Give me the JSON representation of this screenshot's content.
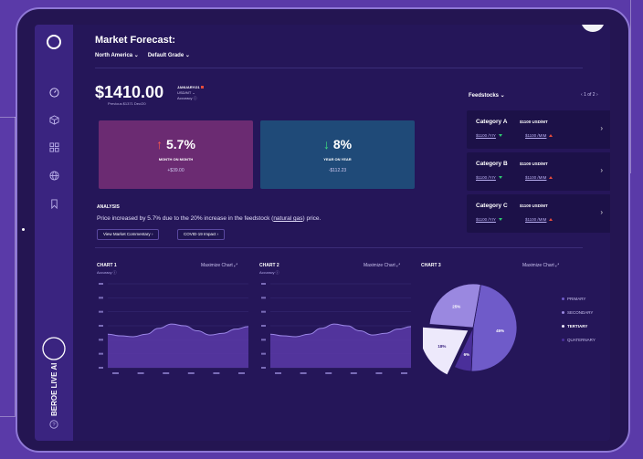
{
  "header": {
    "title": "Market Forecast:",
    "region": "North America",
    "grade": "Default Grade"
  },
  "price": {
    "value": "$1410.00",
    "date": "JANUARY/21",
    "unit": "USD/MT",
    "accuracy_label": "Accuracy",
    "previous": "Previous $1371 Dec/20"
  },
  "kpis": [
    {
      "value": "5.7%",
      "label": "MONTH ON MONTH",
      "amount": "+$39.00",
      "direction": "up",
      "color": "#6b2b72"
    },
    {
      "value": "8%",
      "label": "YEAR ON YEAR",
      "amount": "-$112.23",
      "direction": "down",
      "color": "#1f4a78"
    }
  ],
  "analysis": {
    "heading": "ANALYSIS",
    "text_before": "Price increased by 5.7% due to the 20% increase in the feedstock (",
    "text_link": "natural gas",
    "text_after": ") price.",
    "btn_commentary": "View Market Commentary",
    "btn_covid": "COVID-19 Impact"
  },
  "feedstocks": {
    "heading": "Feedstocks",
    "pager": "1 of 2",
    "items": [
      {
        "name": "Category A",
        "price": "$1100 USD/MT",
        "yoy": "$1100 /YIY",
        "mom": "$1100 /MIM"
      },
      {
        "name": "Category B",
        "price": "$1100 USD/MT",
        "yoy": "$1100 /YIY",
        "mom": "$1100 /MIM"
      },
      {
        "name": "Category C",
        "price": "$1100 USD/MT",
        "yoy": "$1100 /YIY",
        "mom": "$1100 /MIM"
      }
    ]
  },
  "charts": {
    "chart1": {
      "title": "CHART 1",
      "subtitle": "Accuracy",
      "maximize": "Maximize Chart"
    },
    "chart2": {
      "title": "CHART 2",
      "subtitle": "Accuracy",
      "maximize": "Maximize Chart"
    },
    "chart3": {
      "title": "CHART 3",
      "maximize": "Maximize Chart"
    }
  },
  "chart_data": [
    {
      "type": "area",
      "title": "CHART 1",
      "y": [
        40,
        38,
        37,
        40,
        47,
        52,
        50,
        44,
        39,
        41,
        46,
        49
      ]
    },
    {
      "type": "area",
      "title": "CHART 2",
      "y": [
        40,
        38,
        37,
        40,
        47,
        52,
        50,
        44,
        39,
        41,
        46,
        49
      ]
    },
    {
      "type": "pie",
      "title": "CHART 3",
      "slices": [
        {
          "name": "PRIMARY",
          "value": 45,
          "label": "45%",
          "color": "#6f5bc9"
        },
        {
          "name": "SECONDARY",
          "value": 25,
          "label": "25%",
          "color": "#9a88e0"
        },
        {
          "name": "TERTIARY",
          "value": 18,
          "label": "18%",
          "color": "#ede9fb"
        },
        {
          "name": "QUATERNARY",
          "value": 6,
          "label": "6%",
          "color": "#4a2f9a"
        }
      ]
    }
  ],
  "brand": {
    "text": "BEROE LIVE AI"
  }
}
